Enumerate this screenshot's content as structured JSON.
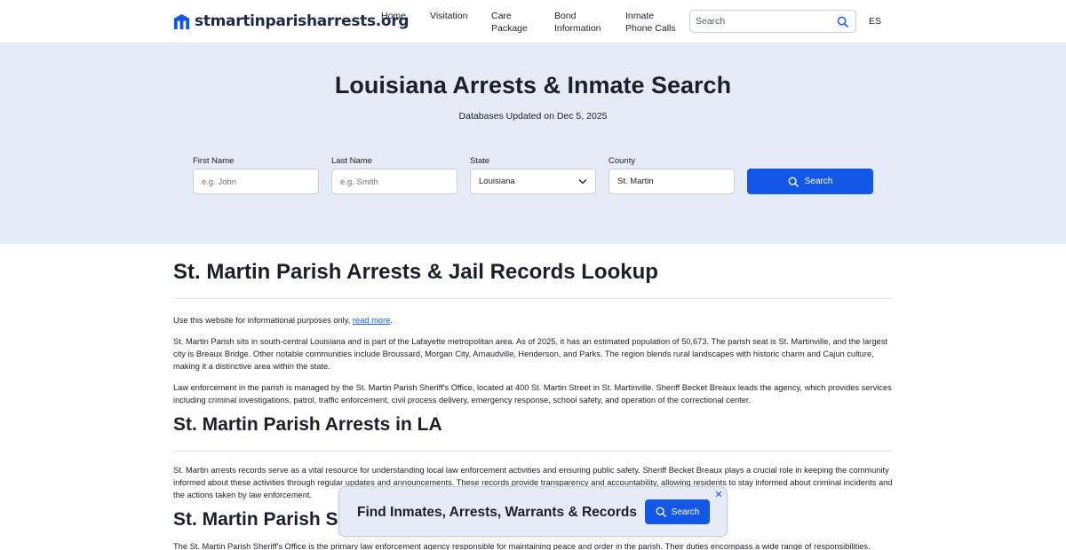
{
  "header": {
    "logo_text": "stmartinparisharrests.org",
    "logo_icon": "building-icon",
    "nav": [
      {
        "label": "Home"
      },
      {
        "label": "Visitation"
      },
      {
        "label": "Care\nPackage"
      },
      {
        "label": "Bond\nInformation"
      },
      {
        "label": "Inmate\nPhone Calls"
      }
    ],
    "search_placeholder": "Search",
    "lang": "ES"
  },
  "hero": {
    "title": "Louisiana Arrests & Inmate Search",
    "subtitle": "Databases Updated on Dec 5, 2025",
    "first_name": {
      "label": "First Name",
      "placeholder": "e.g. John"
    },
    "last_name": {
      "label": "Last Name",
      "placeholder": "e.g. Smith"
    },
    "state": {
      "label": "State",
      "value": "Louisiana"
    },
    "county": {
      "label": "County",
      "value": "St. Martin"
    },
    "search_button": "Search"
  },
  "content": {
    "h1": "St. Martin Parish Arrests & Jail Records Lookup",
    "disclaimer_prefix": "Use this website for informational purposes only, ",
    "disclaimer_link": "read more",
    "disclaimer_suffix": ".",
    "p1": "St. Martin Parish sits in south-central Louisiana and is part of the Lafayette metropolitan area. As of 2025, it has an estimated population of 50,673. The parish seat is St. Martinville, and the largest city is Breaux Bridge. Other notable communities include Broussard, Morgan City, Arnaudville, Henderson, and Parks. The region blends rural landscapes with historic charm and Cajun culture, making it a distinctive area within the state.",
    "p2": "Law enforcement in the parish is managed by the St. Martin Parish Sheriff's Office, located at 400 St. Martin Street in St. Martinville. Sheriff Becket Breaux leads the agency, which provides services including criminal investigations, patrol, traffic enforcement, civil process delivery, emergency response, school safety, and operation of the correctional center.",
    "h2_arrests": "St. Martin Parish Arrests in LA",
    "p3": "St. Martin arrests records serve as a vital resource for understanding local law enforcement activities and ensuring public safety. Sheriff Becket Breaux plays a crucial role in keeping the community informed about these activities through regular updates and announcements. These records provide transparency and accountability, allowing residents to stay informed about criminal incidents and the actions taken by law enforcement.",
    "h2_sheriff": "St. Martin Parish Sheriff's Office",
    "p4": "The St. Martin Parish Sheriff's Office is the primary law enforcement agency responsible for maintaining peace and order in the parish. Their duties encompass a wide range of responsibilities."
  },
  "banner": {
    "text": "Find Inmates, Arrests, Warrants & Records",
    "button": "Search",
    "close": "✕"
  },
  "colors": {
    "accent": "#1357e8",
    "hero_bg": "#e6ebf8",
    "text": "#1b1f2a"
  }
}
